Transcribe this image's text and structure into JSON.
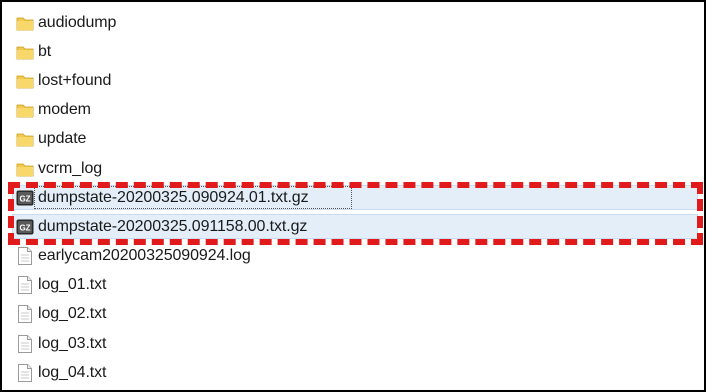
{
  "files": [
    {
      "name": "audiodump",
      "type": "folder",
      "icon": "folder-icon"
    },
    {
      "name": "bt",
      "type": "folder",
      "icon": "folder-icon"
    },
    {
      "name": "lost+found",
      "type": "folder",
      "icon": "folder-icon"
    },
    {
      "name": "modem",
      "type": "folder",
      "icon": "folder-icon"
    },
    {
      "name": "update",
      "type": "folder",
      "icon": "folder-icon"
    },
    {
      "name": "vcrm_log",
      "type": "folder",
      "icon": "folder-icon"
    },
    {
      "name": "dumpstate-20200325.090924.01.txt.gz",
      "type": "gz",
      "icon": "gz-archive-icon",
      "selected": true
    },
    {
      "name": "dumpstate-20200325.091158.00.txt.gz",
      "type": "gz",
      "icon": "gz-archive-icon",
      "selected": true
    },
    {
      "name": "earlycam20200325090924.log",
      "type": "text",
      "icon": "text-file-icon"
    },
    {
      "name": "log_01.txt",
      "type": "text",
      "icon": "text-file-icon"
    },
    {
      "name": "log_02.txt",
      "type": "text",
      "icon": "text-file-icon"
    },
    {
      "name": "log_03.txt",
      "type": "text",
      "icon": "text-file-icon"
    },
    {
      "name": "log_04.txt",
      "type": "text",
      "icon": "text-file-icon"
    }
  ],
  "archive_badge": "GZ",
  "colors": {
    "highlight_dash": "#e11b1b",
    "selection_bg": "#e3eef9",
    "folder": "#f2c94c"
  }
}
